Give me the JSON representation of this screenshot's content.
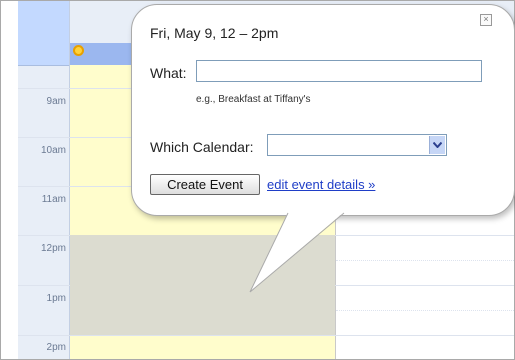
{
  "calendar": {
    "hours": [
      "9am",
      "10am",
      "11am",
      "12pm",
      "1pm",
      "2pm"
    ]
  },
  "bubble": {
    "title": "Fri, May 9, 12 – 2pm",
    "close_glyph": "×",
    "what_label": "What:",
    "what_value": "",
    "what_hint": "e.g., Breakfast at Tiffany's",
    "which_calendar_label": "Which Calendar:",
    "which_calendar_value": "",
    "create_event_label": "Create Event",
    "edit_details_label": "edit event details »"
  },
  "colors": {
    "today_column": "#fffdcc",
    "selection": "#dcdcd0",
    "header_blue": "#c3d9ff",
    "link": "#1f3ec7"
  },
  "icons": {
    "all_day": "sun-icon",
    "close": "close-icon",
    "dropdown": "chevron-down-icon"
  }
}
